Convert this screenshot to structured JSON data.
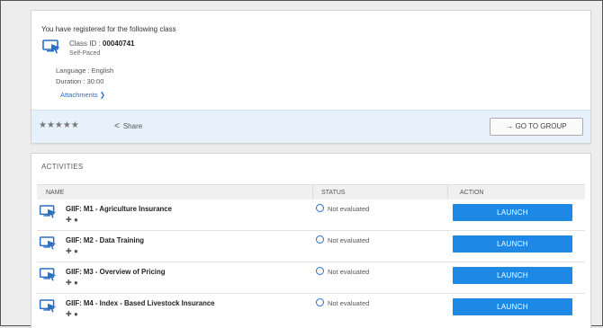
{
  "registration": {
    "intro": "You have registered for the following class",
    "class_id_label": "Class ID : ",
    "class_id": "00040741",
    "type": "Self-Paced",
    "language": "Language : English",
    "duration": "Duration : 30:00",
    "attachments": "Attachments ❯"
  },
  "toolbar": {
    "stars": "★★★★★",
    "share_label": "Share",
    "goto_group": "→  GO TO GROUP"
  },
  "activities": {
    "title": "ACTIVITIES",
    "headers": {
      "name": "NAME",
      "status": "STATUS",
      "action": "ACTION"
    },
    "rows": [
      {
        "title": "GIIF: M1 - Agriculture Insurance",
        "status": "Not evaluated",
        "action": "LAUNCH"
      },
      {
        "title": "GIIF: M2 - Data Training",
        "status": "Not evaluated",
        "action": "LAUNCH"
      },
      {
        "title": "GIIF: M3 - Overview of Pricing",
        "status": "Not evaluated",
        "action": "LAUNCH"
      },
      {
        "title": "GIIF: M4 - Index - Based Livestock Insurance",
        "status": "Not evaluated",
        "action": "LAUNCH"
      }
    ]
  },
  "icons": {
    "class": "computer-cursor-icon",
    "share": "share-icon",
    "status": "empty-circle-icon",
    "platforms": [
      "android-icon",
      "apple-icon"
    ]
  },
  "colors": {
    "accent": "#1e88e5",
    "toolbar_bg": "#e7f1fb",
    "link": "#2b6cc4"
  }
}
